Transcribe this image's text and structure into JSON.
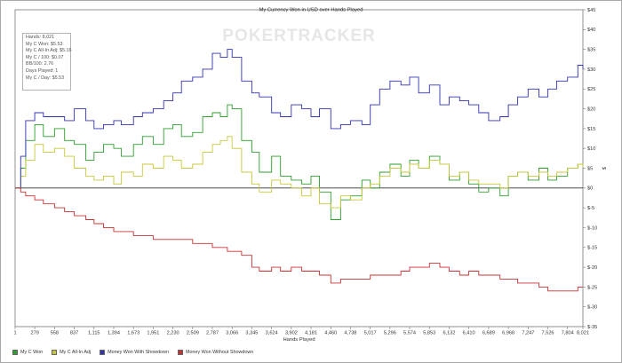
{
  "stats": [
    "Hands: 8,021",
    "My C Won: $5.53",
    "My C All-In Adj: $5.16",
    "My C / 100: $0.07",
    "BB/100: 2.76",
    "Days Played: 1",
    "My C / Day: $5.53"
  ],
  "watermark": "POKERTRACKER",
  "chart_data": {
    "type": "line",
    "title": "My Currency Won in USD over Hands Played",
    "xlabel": "Hands Played",
    "ylabel": "$",
    "xlim": [
      1,
      8021
    ],
    "ylim": [
      -35,
      45
    ],
    "x_ticks": [
      1,
      279,
      558,
      837,
      1115,
      1394,
      1673,
      1951,
      2230,
      2509,
      2787,
      3066,
      3345,
      3624,
      3902,
      4181,
      4460,
      4738,
      5017,
      5296,
      5574,
      5853,
      6132,
      6410,
      6689,
      6968,
      7247,
      7526,
      7804,
      8021
    ],
    "x_tick_labels": [
      "1",
      "279",
      "558",
      "837",
      "1,115",
      "1,394",
      "1,673",
      "1,951",
      "2,230",
      "2,509",
      "2,787",
      "3,066",
      "3,345",
      "3,624",
      "3,902",
      "4,181",
      "4,460",
      "4,738",
      "5,017",
      "5,296",
      "5,574",
      "5,853",
      "6,132",
      "6,410",
      "6,689",
      "6,968",
      "7,247",
      "7,526",
      "7,804",
      "8,021"
    ],
    "y_ticks": [
      -35,
      -30,
      -25,
      -20,
      -15,
      -10,
      -5,
      0,
      5,
      10,
      15,
      20,
      25,
      30,
      35,
      40,
      45
    ],
    "y_tick_labels": [
      "$-35",
      "$-30",
      "$-25",
      "$-20",
      "$-15",
      "$-10",
      "$-5",
      "$0",
      "$5",
      "$10",
      "$15",
      "$20",
      "$25",
      "$30",
      "$35",
      "$40",
      "$45"
    ],
    "grid": true,
    "legend_position": "bottom-left",
    "series": [
      {
        "name": "My C Won",
        "color": "#2e9e2e",
        "x": [
          1,
          80,
          150,
          279,
          400,
          558,
          700,
          837,
          1000,
          1115,
          1250,
          1394,
          1500,
          1673,
          1800,
          1951,
          2100,
          2230,
          2350,
          2509,
          2650,
          2787,
          2900,
          3000,
          3066,
          3200,
          3345,
          3450,
          3624,
          3750,
          3902,
          4050,
          4181,
          4300,
          4460,
          4600,
          4738,
          4900,
          5017,
          5150,
          5296,
          5450,
          5574,
          5700,
          5853,
          6000,
          6132,
          6280,
          6410,
          6550,
          6689,
          6850,
          6968,
          7100,
          7247,
          7400,
          7526,
          7650,
          7804,
          7950,
          8021
        ],
        "y": [
          0,
          5,
          12,
          16,
          13,
          15,
          12,
          11,
          7,
          9,
          11,
          10,
          8,
          11,
          13,
          11,
          15,
          16,
          13,
          14,
          18,
          19,
          18,
          21,
          20,
          12,
          9,
          4,
          8,
          3,
          2,
          1,
          3,
          -1,
          -8,
          -3,
          -2,
          2,
          0,
          4,
          6,
          3,
          7,
          5,
          8,
          6,
          2,
          4,
          1,
          -1,
          0,
          -2,
          3,
          4,
          2,
          5,
          2,
          3,
          5,
          6,
          5.5
        ]
      },
      {
        "name": "My C All-In Adj",
        "color": "#c8c83c",
        "x": [
          1,
          80,
          150,
          279,
          400,
          558,
          700,
          837,
          1000,
          1115,
          1250,
          1394,
          1500,
          1673,
          1800,
          1951,
          2100,
          2230,
          2350,
          2509,
          2650,
          2787,
          2900,
          3000,
          3066,
          3200,
          3345,
          3450,
          3624,
          3750,
          3902,
          4050,
          4181,
          4300,
          4460,
          4600,
          4738,
          4900,
          5017,
          5150,
          5296,
          5450,
          5574,
          5700,
          5853,
          6000,
          6132,
          6280,
          6410,
          6550,
          6689,
          6850,
          6968,
          7100,
          7247,
          7400,
          7526,
          7650,
          7804,
          7950,
          8021
        ],
        "y": [
          0,
          3,
          7,
          11,
          9,
          10,
          8,
          5,
          3,
          2,
          3,
          1,
          4,
          3,
          6,
          5,
          8,
          7,
          5,
          6,
          9,
          11,
          12,
          13,
          10,
          4,
          1,
          -1,
          2,
          1,
          0,
          -2,
          0,
          -4,
          -5,
          -2,
          -3,
          0,
          1,
          3,
          5,
          4,
          6,
          5,
          7,
          6,
          3,
          4,
          2,
          1,
          1,
          0,
          3,
          4,
          3,
          4,
          3,
          4,
          5,
          6,
          5.2
        ]
      },
      {
        "name": "Money Won With Showdown",
        "color": "#3232b4",
        "x": [
          1,
          80,
          150,
          279,
          400,
          558,
          700,
          837,
          1000,
          1115,
          1250,
          1394,
          1500,
          1673,
          1800,
          1951,
          2100,
          2230,
          2350,
          2509,
          2650,
          2787,
          2900,
          3000,
          3066,
          3200,
          3345,
          3450,
          3624,
          3750,
          3902,
          4050,
          4181,
          4300,
          4460,
          4600,
          4738,
          4900,
          5017,
          5150,
          5296,
          5450,
          5574,
          5700,
          5853,
          6000,
          6132,
          6280,
          6410,
          6550,
          6689,
          6850,
          6968,
          7100,
          7247,
          7400,
          7526,
          7650,
          7804,
          7950,
          8021
        ],
        "y": [
          0,
          8,
          17,
          19,
          18,
          18,
          17,
          20,
          17,
          15,
          16,
          17,
          16,
          18,
          19,
          20,
          22,
          24,
          27,
          28,
          30,
          34,
          33,
          35,
          33,
          27,
          24,
          23,
          19,
          18,
          21,
          20,
          18,
          20,
          15,
          16,
          17,
          16,
          21,
          25,
          27,
          26,
          28,
          24,
          26,
          21,
          23,
          22,
          21,
          19,
          17,
          18,
          21,
          23,
          25,
          23,
          25,
          27,
          28,
          31,
          30
        ]
      },
      {
        "name": "Money Won Without Showdown",
        "color": "#c83232",
        "x": [
          1,
          80,
          150,
          279,
          400,
          558,
          700,
          837,
          1000,
          1115,
          1250,
          1394,
          1500,
          1673,
          1800,
          1951,
          2100,
          2230,
          2350,
          2509,
          2650,
          2787,
          2900,
          3000,
          3066,
          3200,
          3345,
          3450,
          3624,
          3750,
          3902,
          4050,
          4181,
          4300,
          4460,
          4600,
          4738,
          4900,
          5017,
          5150,
          5296,
          5450,
          5574,
          5700,
          5853,
          6000,
          6132,
          6280,
          6410,
          6550,
          6689,
          6850,
          6968,
          7100,
          7247,
          7400,
          7526,
          7650,
          7804,
          7950,
          8021
        ],
        "y": [
          0,
          -1,
          -2,
          -3,
          -4,
          -5,
          -6,
          -7,
          -8,
          -9,
          -10,
          -11,
          -11,
          -12,
          -12,
          -13,
          -13,
          -13,
          -13,
          -14,
          -14,
          -15,
          -15,
          -16,
          -16,
          -17,
          -20,
          -21,
          -20,
          -21,
          -20,
          -21,
          -21,
          -22,
          -24,
          -23,
          -23,
          -23,
          -22,
          -22,
          -22,
          -21,
          -20,
          -20,
          -19,
          -20,
          -21,
          -22,
          -21,
          -22,
          -22,
          -23,
          -23,
          -24,
          -24,
          -25,
          -26,
          -26,
          -26,
          -25,
          -25
        ]
      }
    ]
  }
}
